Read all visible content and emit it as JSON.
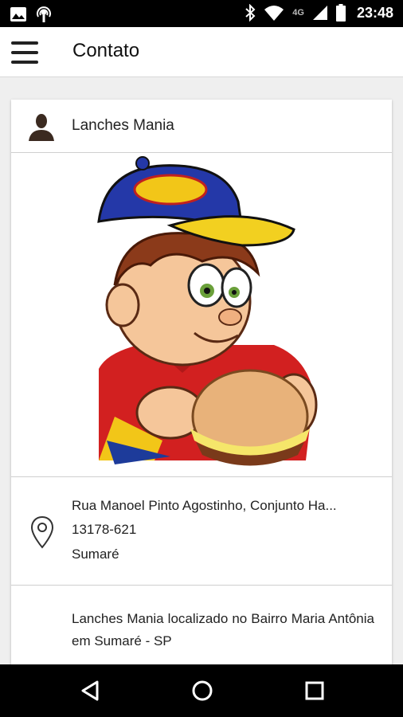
{
  "status_bar": {
    "time": "23:48",
    "network": "4G",
    "icons": [
      "image-icon",
      "podcast-icon",
      "bluetooth-icon",
      "wifi-icon",
      "signal-icon",
      "battery-icon"
    ]
  },
  "app_bar": {
    "title": "Contato",
    "menu_icon": "menu-icon"
  },
  "card": {
    "title": "Lanches Mania",
    "header_icon": "person-icon",
    "logo_alt": "Lanches Mania mascot",
    "address": {
      "icon": "map-pin-icon",
      "street": "Rua Manoel Pinto Agostinho, Conjunto Ha...",
      "cep": "13178-621",
      "city": "Sumaré"
    },
    "description": "Lanches Mania localizado no Bairro Maria Antônia em Sumaré - SP"
  },
  "nav_bar": {
    "icons": [
      "back-icon",
      "home-icon",
      "recents-icon"
    ]
  },
  "colors": {
    "status_bar": "#000000",
    "app_bar": "#ffffff",
    "background": "#efefef",
    "text": "#222222",
    "divider": "#cfcfcf"
  }
}
